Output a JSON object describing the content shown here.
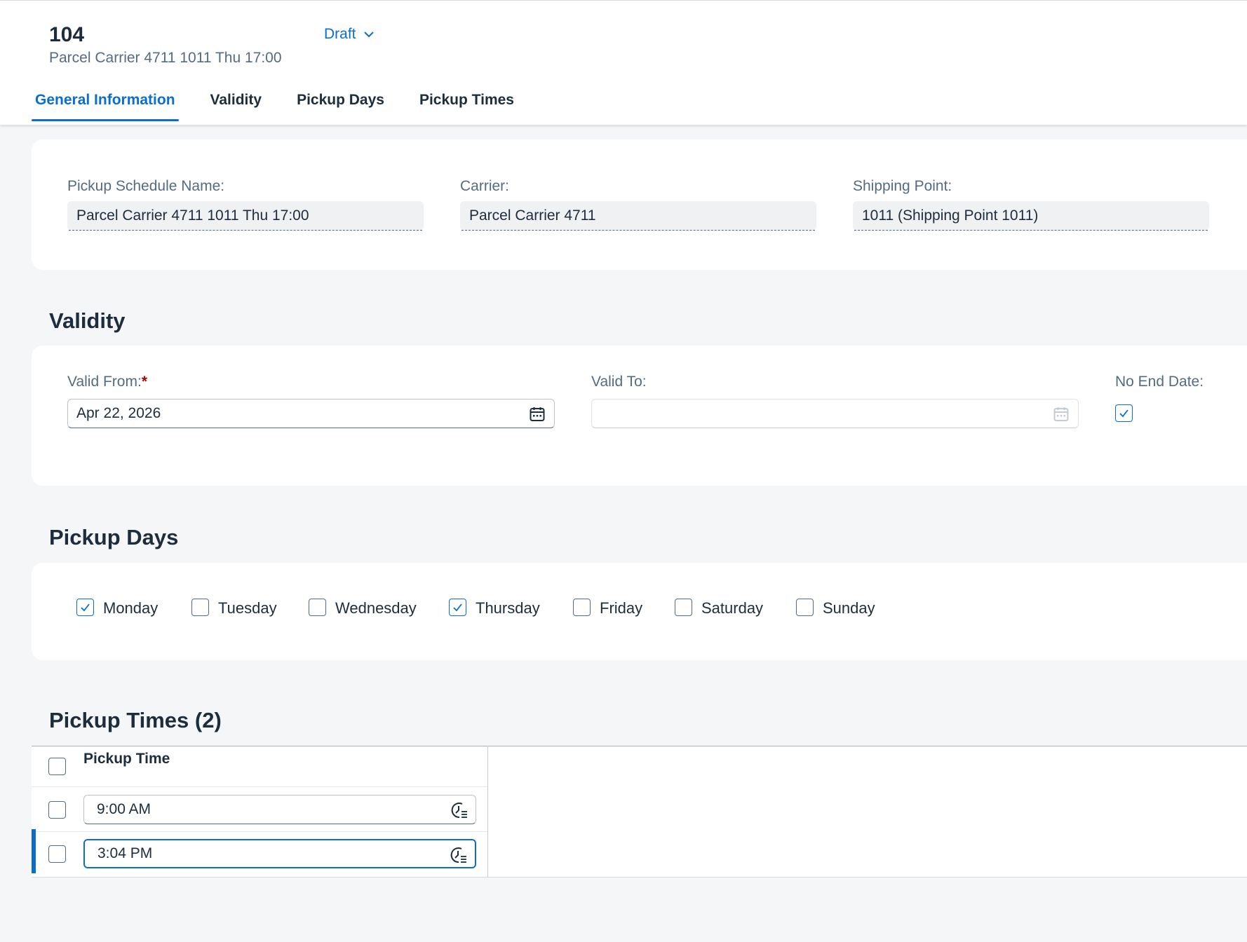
{
  "header": {
    "object_id": "104",
    "subtitle": "Parcel Carrier 4711 1011 Thu 17:00",
    "draft_label": "Draft",
    "tabs": [
      "General Information",
      "Validity",
      "Pickup Days",
      "Pickup Times"
    ],
    "active_tab": "General Information"
  },
  "general": {
    "schedule_name_label": "Pickup Schedule Name:",
    "schedule_name_value": "Parcel Carrier 4711 1011 Thu 17:00",
    "carrier_label": "Carrier:",
    "carrier_value": "Parcel Carrier 4711",
    "shipping_point_label": "Shipping Point:",
    "shipping_point_value": "1011 (Shipping Point 1011)"
  },
  "validity": {
    "title": "Validity",
    "valid_from_label": "Valid From:",
    "required_marker": "*",
    "valid_from_value": "Apr 22, 2026",
    "valid_to_label": "Valid To:",
    "valid_to_value": "",
    "no_end_date_label": "No End Date:",
    "no_end_date_checked": true
  },
  "pickup_days": {
    "title": "Pickup Days",
    "days": [
      {
        "label": "Monday",
        "checked": true
      },
      {
        "label": "Tuesday",
        "checked": false
      },
      {
        "label": "Wednesday",
        "checked": false
      },
      {
        "label": "Thursday",
        "checked": true
      },
      {
        "label": "Friday",
        "checked": false
      },
      {
        "label": "Saturday",
        "checked": false
      },
      {
        "label": "Sunday",
        "checked": false
      }
    ]
  },
  "pickup_times": {
    "title": "Pickup Times (2)",
    "column_header": "Pickup Time",
    "rows": [
      {
        "time": "9:00 AM",
        "selected": false
      },
      {
        "time": "3:04 PM",
        "selected": false
      }
    ]
  },
  "colors": {
    "accent": "#0a6ed1",
    "text": "#1d2d3e",
    "label": "#556b82",
    "required": "#aa0808",
    "background": "#f5f6f7"
  }
}
